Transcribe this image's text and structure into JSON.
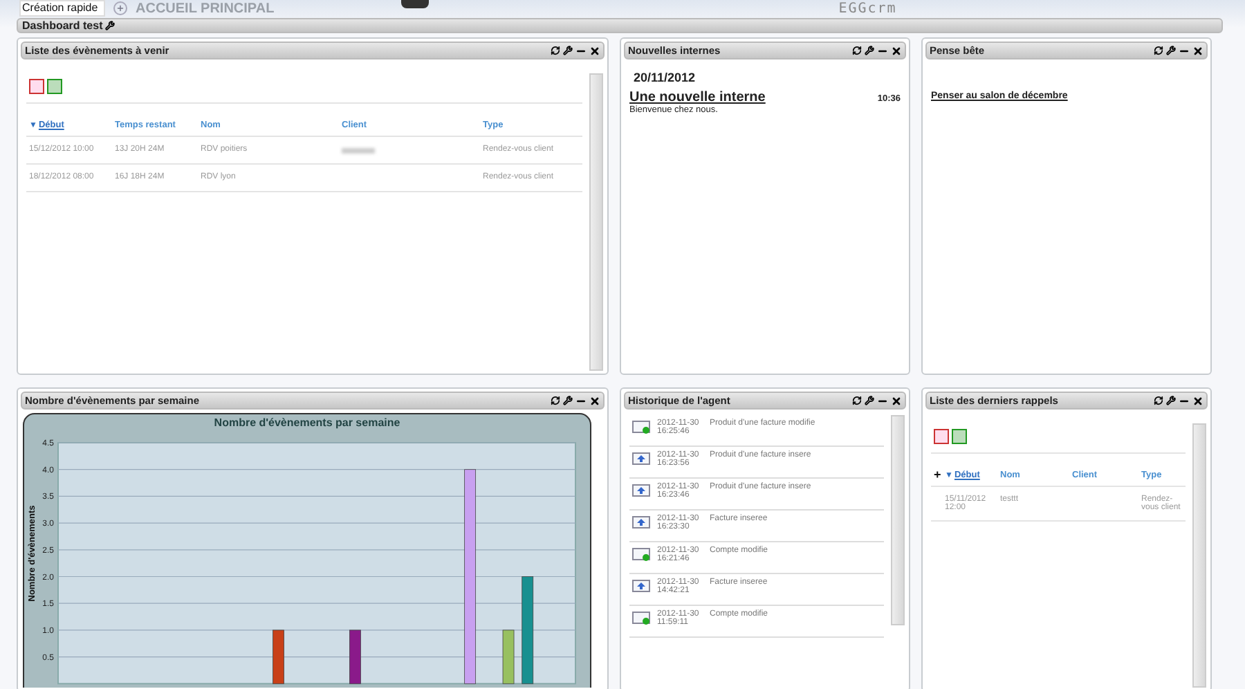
{
  "topbar": {
    "quick_create": "Création rapide",
    "page_title": "ACCUEIL PRINCIPAL",
    "logo": "EGGcrm"
  },
  "dashboard": {
    "title": "Dashboard test"
  },
  "widgets": [
    {
      "kind": "events",
      "title": "Liste des évènements à venir",
      "sort_caret": "▼",
      "columns": [
        {
          "label": "Début",
          "sorted": true
        },
        {
          "label": "Temps restant",
          "sorted": false
        },
        {
          "label": "Nom",
          "sorted": false
        },
        {
          "label": "Client",
          "sorted": false
        },
        {
          "label": "Type",
          "sorted": false
        }
      ],
      "rows": [
        {
          "start": "15/12/2012 10:00",
          "remaining": "13J 20H 24M",
          "name": "RDV poitiers",
          "client_blurred": true,
          "type": "Rendez-vous client"
        },
        {
          "start": "18/12/2012 08:00",
          "remaining": "16J 18H 24M",
          "name": "RDV lyon",
          "client_blurred": false,
          "type": "Rendez-vous client"
        }
      ]
    },
    {
      "kind": "news",
      "title": "Nouvelles internes",
      "date": "20/11/2012",
      "items": [
        {
          "title": "Une nouvelle interne",
          "time": "10:36",
          "body": "Bienvenue chez nous."
        }
      ]
    },
    {
      "kind": "memo",
      "title": "Pense bête",
      "notes": [
        "Penser au salon de décembre"
      ]
    },
    {
      "kind": "chart",
      "title": "Nombre d'évènements par semaine",
      "chart_data": {
        "type": "bar",
        "title": "Nombre d'évènements par semaine",
        "ylabel": "Nombre d'évènements",
        "ylim": [
          0,
          4.5
        ],
        "grid": true,
        "yticks": [
          {
            "value": 0.5,
            "label": "0.5"
          },
          {
            "value": 1,
            "label": "1.0"
          },
          {
            "value": 1.5,
            "label": "1.5"
          },
          {
            "value": 2,
            "label": "2.0"
          },
          {
            "value": 2.5,
            "label": "2.5"
          },
          {
            "value": 3,
            "label": "3.0"
          },
          {
            "value": 3.5,
            "label": "3.5"
          },
          {
            "value": 4,
            "label": "4.0"
          },
          {
            "value": 4.5,
            "label": "4.5"
          }
        ],
        "colors": [
          null,
          null,
          null,
          null,
          null,
          null,
          null,
          null,
          null,
          null,
          null,
          "#c84018",
          null,
          null,
          null,
          "#8a1a8a",
          null,
          null,
          null,
          null,
          null,
          "#c8a0f0",
          null,
          "#98c060",
          "#189090",
          null,
          null
        ],
        "values": [
          null,
          null,
          null,
          null,
          null,
          null,
          null,
          null,
          null,
          null,
          null,
          1,
          null,
          null,
          null,
          1,
          null,
          null,
          null,
          null,
          null,
          4,
          null,
          1,
          2,
          null,
          null
        ]
      }
    },
    {
      "kind": "history",
      "title": "Historique de l'agent",
      "entries": [
        {
          "kind": "modified",
          "date": "2012-11-30",
          "time": "16:25:46",
          "action": "Produit d'une facture modifie"
        },
        {
          "kind": "inserted",
          "date": "2012-11-30",
          "time": "16:23:56",
          "action": "Produit d'une facture insere"
        },
        {
          "kind": "inserted",
          "date": "2012-11-30",
          "time": "16:23:46",
          "action": "Produit d'une facture insere"
        },
        {
          "kind": "inserted",
          "date": "2012-11-30",
          "time": "16:23:30",
          "action": "Facture inseree"
        },
        {
          "kind": "modified",
          "date": "2012-11-30",
          "time": "16:21:46",
          "action": "Compte modifie"
        },
        {
          "kind": "inserted",
          "date": "2012-11-30",
          "time": "14:42:21",
          "action": "Facture inseree"
        },
        {
          "kind": "modified",
          "date": "2012-11-30",
          "time": "11:59:11",
          "action": "Compte modifie"
        }
      ]
    },
    {
      "kind": "reminders",
      "title": "Liste des derniers rappels",
      "add": "+",
      "sort_caret": "▼",
      "columns": [
        {
          "label": "Début",
          "sorted": true
        },
        {
          "label": "Nom",
          "sorted": false
        },
        {
          "label": "Client",
          "sorted": false
        },
        {
          "label": "Type",
          "sorted": false
        }
      ],
      "rows": [
        {
          "start": "15/11/2012 12:00",
          "name": "testtt",
          "type": "Rendez-vous client"
        }
      ]
    }
  ]
}
